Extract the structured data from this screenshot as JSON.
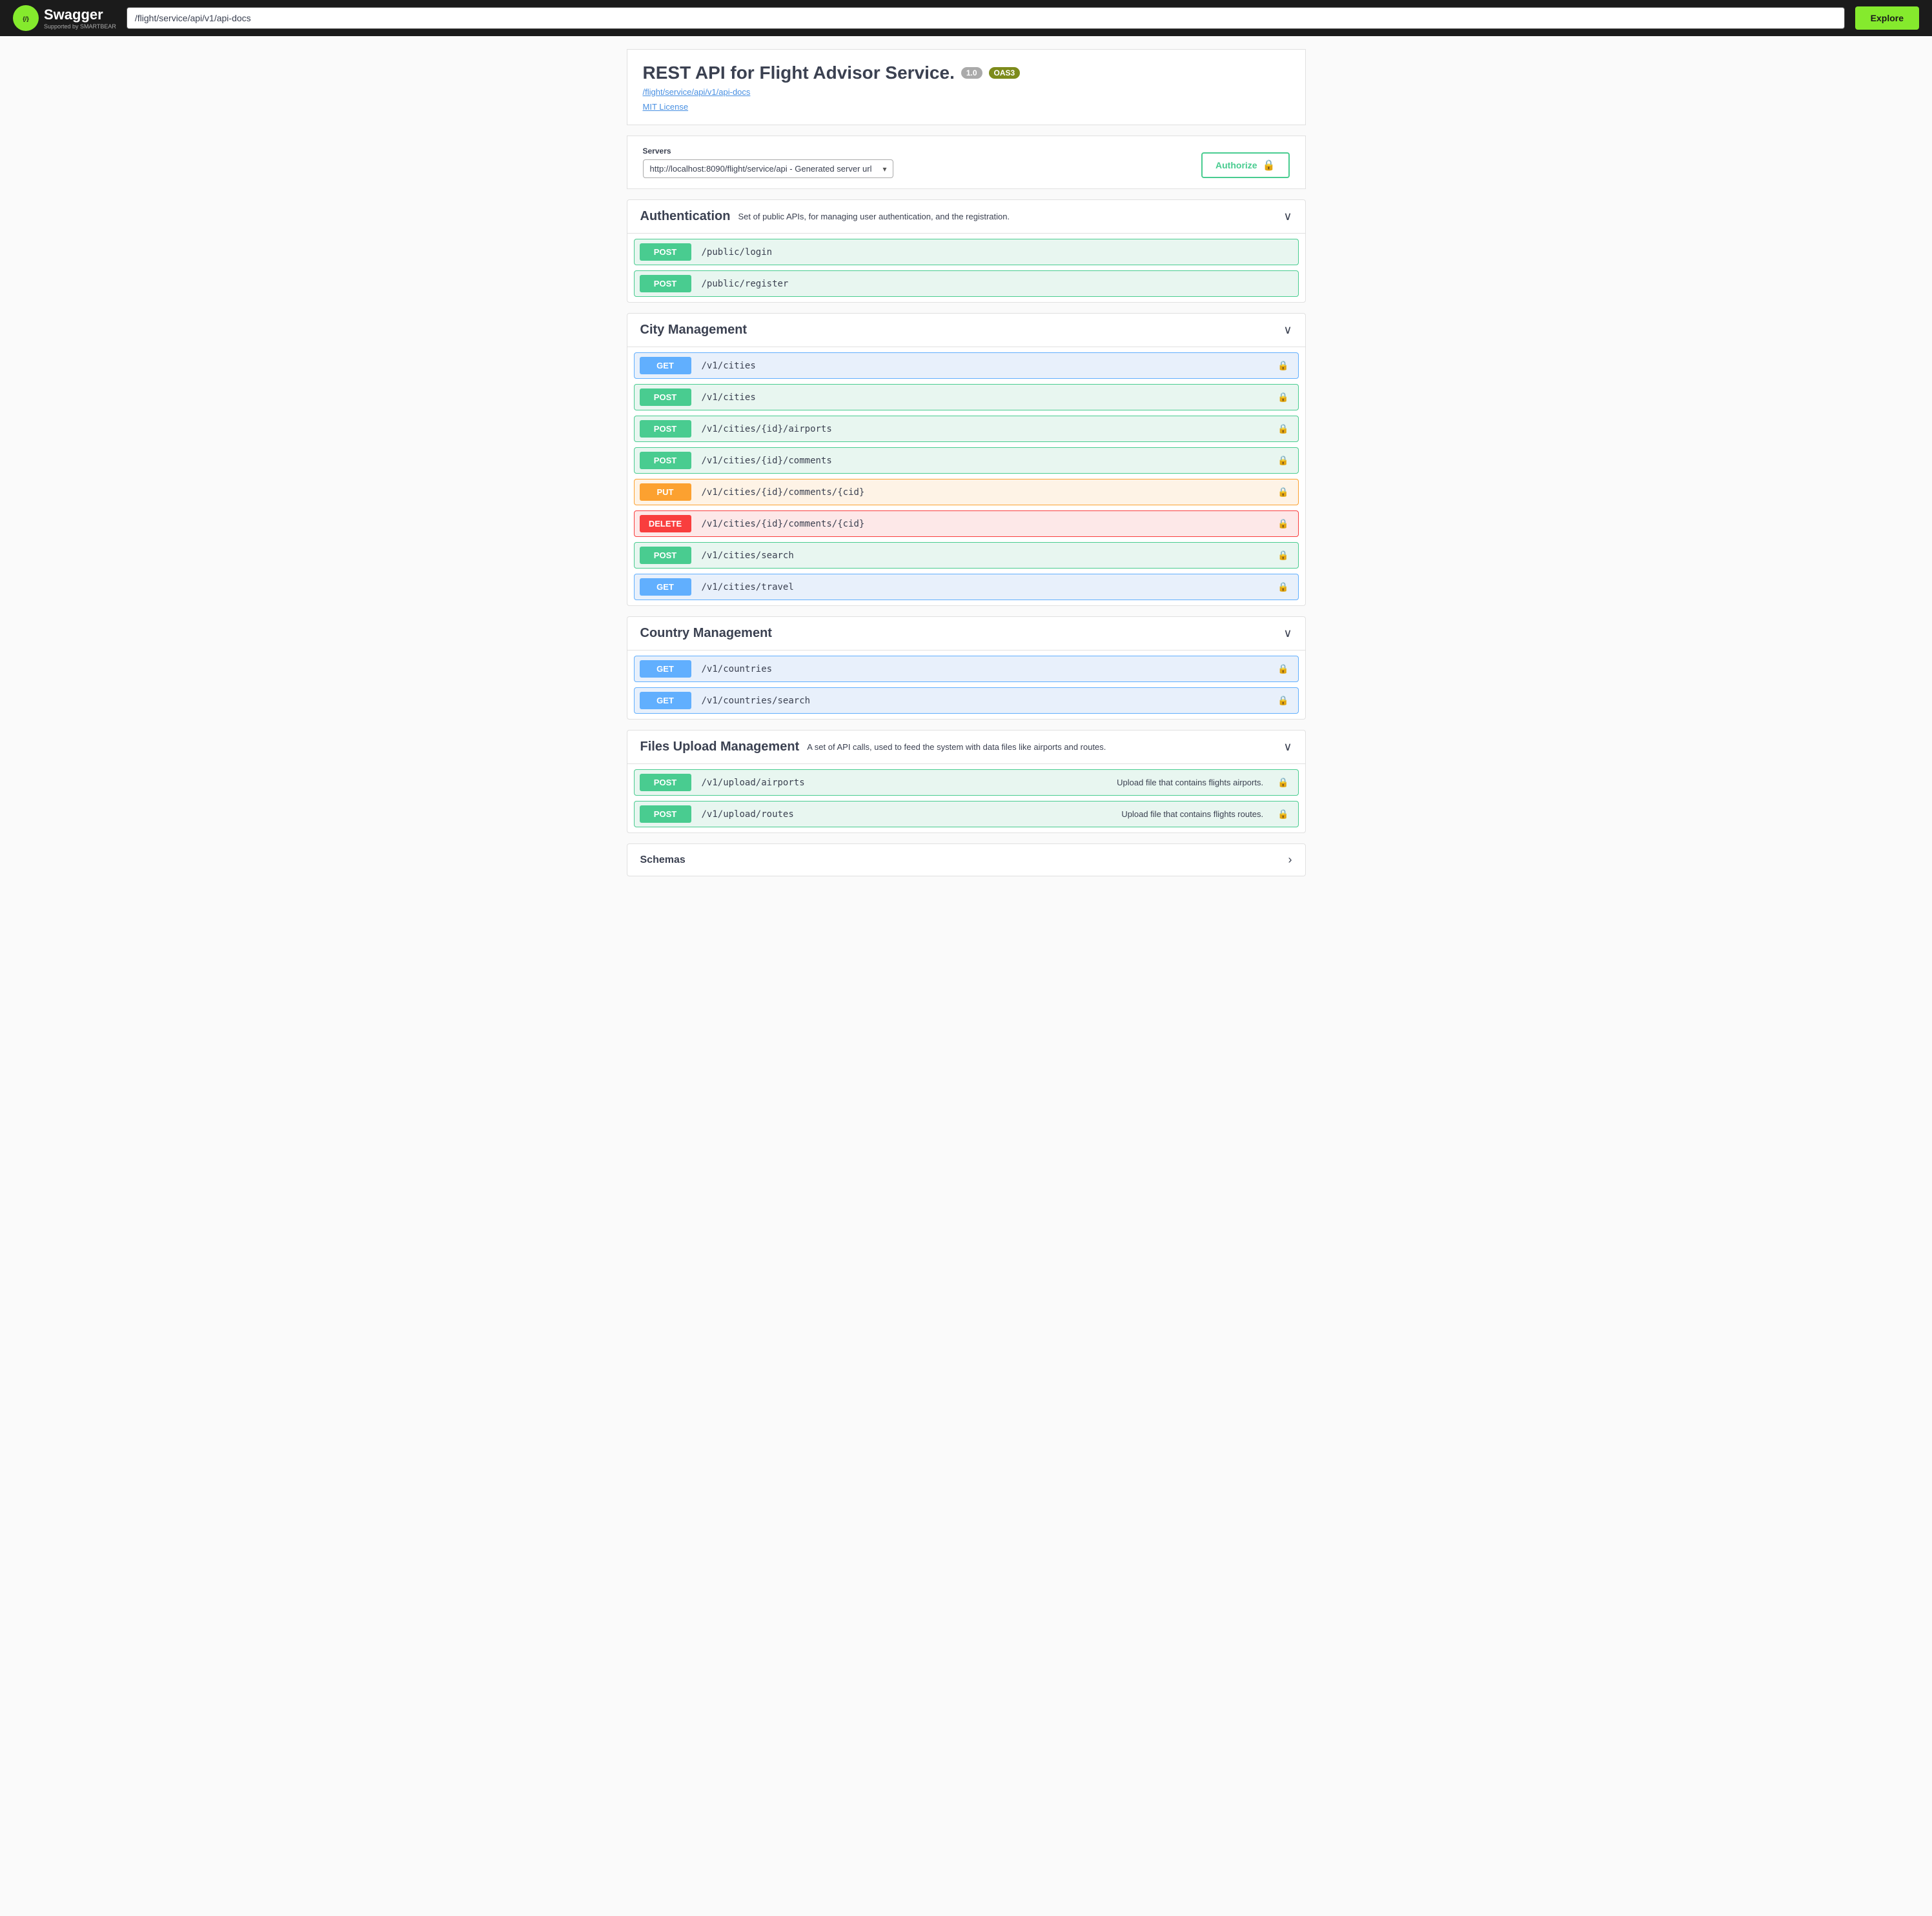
{
  "header": {
    "url_value": "/flight/service/api/v1/api-docs",
    "explore_label": "Explore",
    "logo_text": "Swagger",
    "logo_sub": "Supported by SMARTBEAR"
  },
  "api_info": {
    "title": "REST API for Flight Advisor Service.",
    "version_badge": "1.0",
    "oas_badge": "OAS3",
    "url_link": "/flight/service/api/v1/api-docs",
    "license_link": "MIT License"
  },
  "servers": {
    "label": "Servers",
    "selected": "http://localhost:8090/flight/service/api - Generated server url",
    "options": [
      "http://localhost:8090/flight/service/api - Generated server url"
    ]
  },
  "authorize_btn": "Authorize",
  "sections": [
    {
      "id": "authentication",
      "title": "Authentication",
      "desc": "Set of public APIs, for managing user authentication, and the registration.",
      "endpoints": [
        {
          "method": "POST",
          "path": "/public/login",
          "desc": "",
          "locked": false
        },
        {
          "method": "POST",
          "path": "/public/register",
          "desc": "",
          "locked": false
        }
      ]
    },
    {
      "id": "city-management",
      "title": "City Management",
      "desc": "",
      "endpoints": [
        {
          "method": "GET",
          "path": "/v1/cities",
          "desc": "",
          "locked": true
        },
        {
          "method": "POST",
          "path": "/v1/cities",
          "desc": "",
          "locked": true
        },
        {
          "method": "POST",
          "path": "/v1/cities/{id}/airports",
          "desc": "",
          "locked": true
        },
        {
          "method": "POST",
          "path": "/v1/cities/{id}/comments",
          "desc": "",
          "locked": true
        },
        {
          "method": "PUT",
          "path": "/v1/cities/{id}/comments/{cid}",
          "desc": "",
          "locked": true
        },
        {
          "method": "DELETE",
          "path": "/v1/cities/{id}/comments/{cid}",
          "desc": "",
          "locked": true
        },
        {
          "method": "POST",
          "path": "/v1/cities/search",
          "desc": "",
          "locked": true
        },
        {
          "method": "GET",
          "path": "/v1/cities/travel",
          "desc": "",
          "locked": true
        }
      ]
    },
    {
      "id": "country-management",
      "title": "Country Management",
      "desc": "",
      "endpoints": [
        {
          "method": "GET",
          "path": "/v1/countries",
          "desc": "",
          "locked": true
        },
        {
          "method": "GET",
          "path": "/v1/countries/search",
          "desc": "",
          "locked": true
        }
      ]
    },
    {
      "id": "files-upload",
      "title": "Files Upload Management",
      "desc": "A set of API calls, used to feed the system with data files like airports and routes.",
      "endpoints": [
        {
          "method": "POST",
          "path": "/v1/upload/airports",
          "desc": "Upload file that contains flights airports.",
          "locked": true
        },
        {
          "method": "POST",
          "path": "/v1/upload/routes",
          "desc": "Upload file that contains flights routes.",
          "locked": true
        }
      ]
    }
  ],
  "schemas": {
    "title": "Schemas"
  },
  "icons": {
    "lock": "🔒",
    "chevron_down": "∨",
    "chevron_right": "›"
  }
}
